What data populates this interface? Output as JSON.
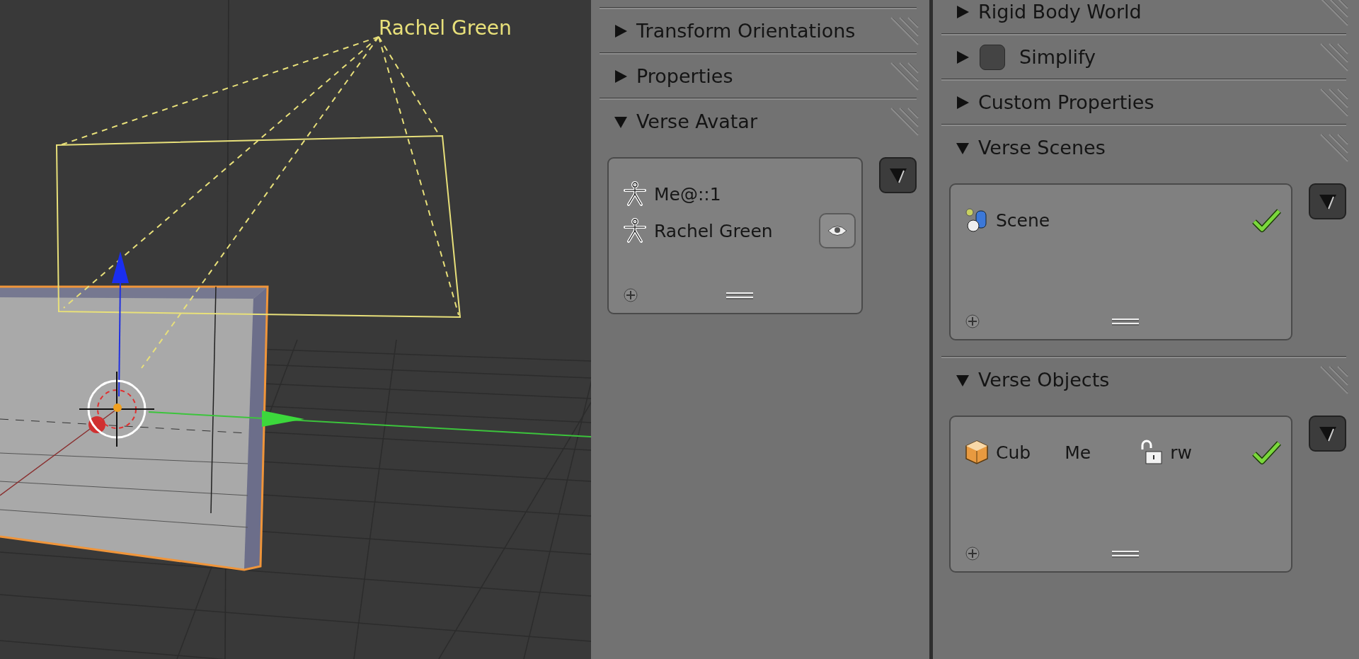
{
  "viewport": {
    "avatar_label": "Rachel Green"
  },
  "panels": [
    {
      "sections": [
        {
          "title": "Transform Orientations",
          "expanded": false
        },
        {
          "title": "Properties",
          "expanded": false
        },
        {
          "title": "Verse Avatar",
          "expanded": true,
          "list": {
            "items": [
              {
                "kind": "avatar",
                "name": "Me@::1",
                "show_eye": false
              },
              {
                "kind": "avatar",
                "name": "Rachel Green",
                "show_eye": true
              }
            ]
          }
        }
      ]
    },
    {
      "sections": [
        {
          "title": "Rigid Body World",
          "expanded": false
        },
        {
          "title": "Simplify",
          "expanded": false,
          "checkbox": {
            "checked": false
          }
        },
        {
          "title": "Custom Properties",
          "expanded": false
        },
        {
          "title": "Verse Scenes",
          "expanded": true,
          "list": {
            "items": [
              {
                "kind": "scene",
                "name": "Scene",
                "active": true
              }
            ]
          }
        },
        {
          "title": "Verse Objects",
          "expanded": true,
          "list": {
            "items": [
              {
                "kind": "object",
                "name": "Cub",
                "owner": "Me",
                "locked": false,
                "permission": "rw",
                "active": true
              }
            ]
          }
        }
      ]
    }
  ]
}
